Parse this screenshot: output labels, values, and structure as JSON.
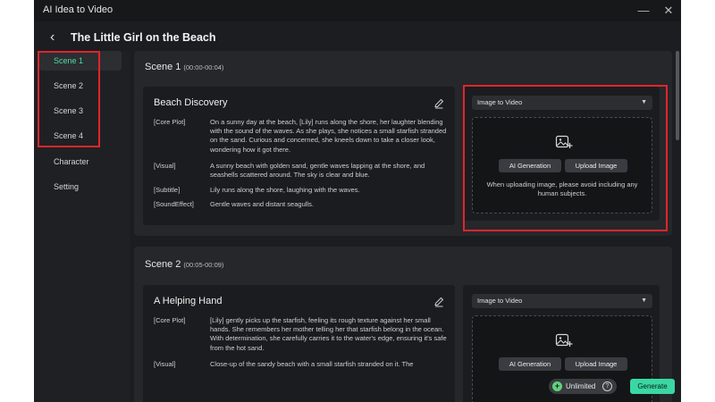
{
  "app": {
    "title": "AI Idea to Video",
    "minimize_glyph": "—",
    "close_glyph": "✕"
  },
  "header": {
    "back_glyph": "‹",
    "page_title": "The Little Girl on the Beach"
  },
  "sidebar": {
    "items": [
      {
        "label": "Scene 1",
        "active": true
      },
      {
        "label": "Scene 2",
        "active": false
      },
      {
        "label": "Scene 3",
        "active": false
      },
      {
        "label": "Scene 4",
        "active": false
      },
      {
        "label": "Character",
        "active": false
      },
      {
        "label": "Setting",
        "active": false
      }
    ]
  },
  "scenes": [
    {
      "name": "Scene 1",
      "time": "(00:00-00:04)",
      "title": "Beach Discovery",
      "rows": [
        {
          "label": "[Core Plot]",
          "text": "On a sunny day at the beach, [Lily] runs along the shore, her laughter blending with the sound of the waves. As she plays, she notices a small starfish stranded on the sand. Curious and concerned, she kneels down to take a closer look, wondering how it got there."
        },
        {
          "label": "[Visual]",
          "text": "A sunny beach with golden sand, gentle waves lapping at the shore, and seashells scattered around. The sky is clear and blue."
        },
        {
          "label": "[Subtitle]",
          "text": "Lily runs along the shore, laughing with the waves."
        },
        {
          "label": "[SoundEffect]",
          "text": "Gentle waves and distant seagulls."
        }
      ],
      "media": {
        "mode": "Image to Video",
        "ai_button": "AI Generation",
        "upload_button": "Upload Image",
        "hint": "When uploading image, please avoid including any human subjects."
      }
    },
    {
      "name": "Scene 2",
      "time": "(00:05-00:09)",
      "title": "A Helping Hand",
      "rows": [
        {
          "label": "[Core Plot]",
          "text": "[Lily] gently picks up the starfish, feeling its rough texture against her small hands. She remembers her mother telling her that starfish belong in the ocean. With determination, she carefully carries it to the water's edge, ensuring it's safe from the hot sand."
        },
        {
          "label": "[Visual]",
          "text": "Close-up of the sandy beach with a small starfish stranded on it. The"
        }
      ],
      "media": {
        "mode": "Image to Video",
        "ai_button": "AI Generation",
        "upload_button": "Upload Image"
      }
    }
  ],
  "footer": {
    "plan_label": "Unlimited",
    "help_glyph": "?",
    "plus_glyph": "+",
    "generate_label": "Generate"
  },
  "colors": {
    "accent": "#3ad7a3",
    "active_nav_text": "#4fdca4",
    "highlight": "#e0252b",
    "background": "#1c1d20"
  },
  "icons": [
    "edit-icon",
    "image-add-icon",
    "chevron-down-icon",
    "back-arrow-icon",
    "close-icon",
    "minimize-icon",
    "help-icon",
    "plus-icon"
  ]
}
